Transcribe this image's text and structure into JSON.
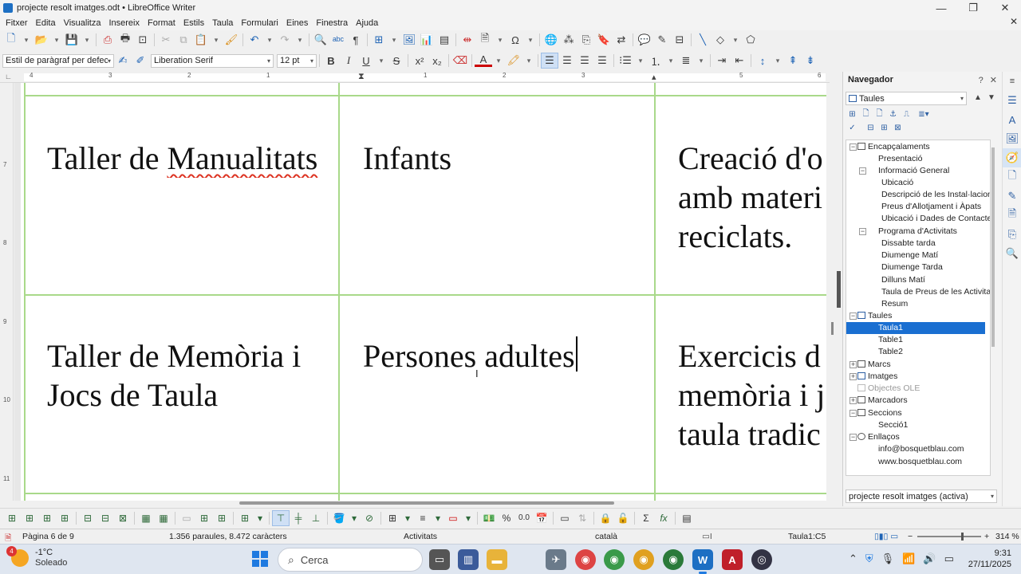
{
  "window": {
    "title": "projecte resolt imatges.odt • LibreOffice Writer",
    "minimize": "—",
    "maximize": "❐",
    "close": "✕"
  },
  "menu": [
    "Fitxer",
    "Edita",
    "Visualitza",
    "Insereix",
    "Format",
    "Estils",
    "Taula",
    "Formulari",
    "Eines",
    "Finestra",
    "Ajuda"
  ],
  "format": {
    "paragraph_style": "Estil de paràgraf per defecte",
    "font_name": "Liberation Serif",
    "font_size": "12 pt"
  },
  "ruler": {
    "h_marks": [
      "4",
      "3",
      "2",
      "1",
      "1",
      "2",
      "3",
      "4",
      "5",
      "6"
    ],
    "v_marks": [
      "7",
      "8",
      "9",
      "10",
      "11"
    ]
  },
  "table": {
    "rows": [
      [
        "Taller de Manualitats",
        "Infants",
        "Creació d'o\namb materi\nreciclats."
      ],
      [
        "Taller de Memòria i\nJocs de Taula",
        "Persones adultes",
        "Exercicis d\nmemòria i j\ntaula tradic"
      ]
    ],
    "misspelled_word": "Manualitats"
  },
  "navigator": {
    "title": "Navegador",
    "category": "Taules",
    "document": "projecte resolt imatges (activa)",
    "tree": [
      {
        "label": "Encapçalaments",
        "level": 0,
        "toggle": "⊟"
      },
      {
        "label": "Presentació",
        "level": 1
      },
      {
        "label": "Informació General",
        "level": 1,
        "toggle": "⊟"
      },
      {
        "label": "Ubicació",
        "level": 2
      },
      {
        "label": "Descripció de les Instal·lacion",
        "level": 2
      },
      {
        "label": "Preus d'Allotjament i Àpats",
        "level": 2
      },
      {
        "label": "Ubicació i Dades de Contacte",
        "level": 2
      },
      {
        "label": "Programa d'Activitats",
        "level": 1,
        "toggle": "⊟"
      },
      {
        "label": "Dissabte tarda",
        "level": 2
      },
      {
        "label": "Diumenge Matí",
        "level": 2
      },
      {
        "label": "Diumenge Tarda",
        "level": 2
      },
      {
        "label": "Dilluns Matí",
        "level": 2
      },
      {
        "label": "Taula de Preus de les Activitat",
        "level": 2
      },
      {
        "label": "Resum",
        "level": 1
      },
      {
        "label": "Taules",
        "level": 0,
        "toggle": "⊟"
      },
      {
        "label": "Taula1",
        "level": 1,
        "selected": true
      },
      {
        "label": "Table1",
        "level": 1
      },
      {
        "label": "Table2",
        "level": 1
      },
      {
        "label": "Marcs",
        "level": 0,
        "toggle": "⊞"
      },
      {
        "label": "Imatges",
        "level": 0,
        "toggle": "⊞"
      },
      {
        "label": "Objectes OLE",
        "level": 0,
        "dim": true
      },
      {
        "label": "Marcadors",
        "level": 0,
        "toggle": "⊞"
      },
      {
        "label": "Seccions",
        "level": 0,
        "toggle": "⊟"
      },
      {
        "label": "Secció1",
        "level": 1
      },
      {
        "label": "Enllaços",
        "level": 0,
        "toggle": "⊟"
      },
      {
        "label": "info@bosquetblau.com",
        "level": 1
      },
      {
        "label": "www.bosquetblau.com",
        "level": 1
      }
    ]
  },
  "status": {
    "page": "Pàgina 6 de 9",
    "words": "1.356 paraules, 8.472 caràcters",
    "style": "Activitats",
    "language": "català",
    "cell": "Taula1:C5",
    "zoom": "314 %"
  },
  "taskbar": {
    "temp": "-1°C",
    "weather": "Soleado",
    "badge": "4",
    "search": "Cerca",
    "time": "9:31",
    "date": "27/11/2025"
  },
  "colors": {
    "selection": "#1a6fd1",
    "table_border": "#a9d98a",
    "spell": "#d32"
  }
}
